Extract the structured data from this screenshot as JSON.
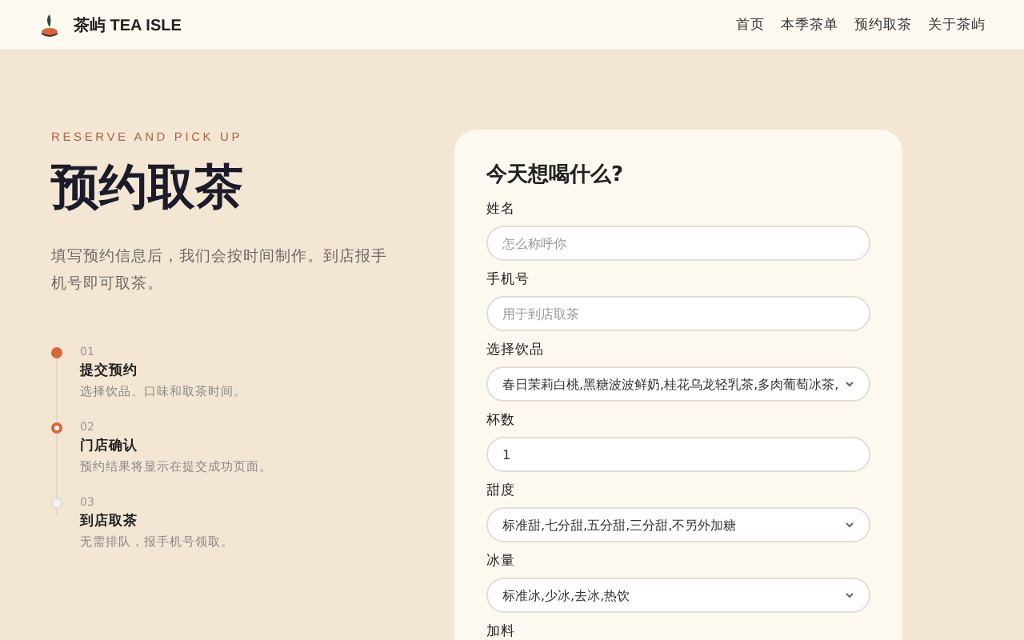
{
  "nav": {
    "brand": "茶屿 TEA ISLE",
    "links": [
      "首页",
      "本季茶单",
      "预约取茶",
      "关于茶屿"
    ]
  },
  "hero": {
    "eyebrow": "RESERVE AND PICK UP",
    "title": "预约取茶",
    "description": "填写预约信息后，我们会按时间制作。到店报手机号即可取茶。"
  },
  "steps": [
    {
      "number": "01",
      "title": "提交预约",
      "text": "选择饮品、口味和取茶时间。",
      "kind": "done"
    },
    {
      "number": "02",
      "title": "门店确认",
      "text": "预约结果将显示在提交成功页面。",
      "kind": "current"
    },
    {
      "number": "03",
      "title": "到店取茶",
      "text": "无需排队，报手机号领取。",
      "kind": "pending"
    }
  ],
  "form": {
    "title": "今天想喝什么?",
    "fields": [
      {
        "label": "姓名",
        "kind": "input",
        "placeholder": "怎么称呼你"
      },
      {
        "label": "手机号",
        "kind": "input",
        "placeholder": "用于到店取茶"
      },
      {
        "label": "选择饮品",
        "kind": "select",
        "value": "春日茉莉白桃,黑糖波波鲜奶,桂花乌龙轻乳茶,多肉葡萄冰茶,"
      },
      {
        "label": "杯数",
        "kind": "input",
        "value": "1"
      },
      {
        "label": "甜度",
        "kind": "select",
        "value": "标准甜,七分甜,五分甜,三分甜,不另外加糖"
      },
      {
        "label": "冰量",
        "kind": "select",
        "value": "标准冰,少冰,去冰,热饮"
      },
      {
        "label": "加料",
        "kind": "label-only"
      }
    ]
  }
}
